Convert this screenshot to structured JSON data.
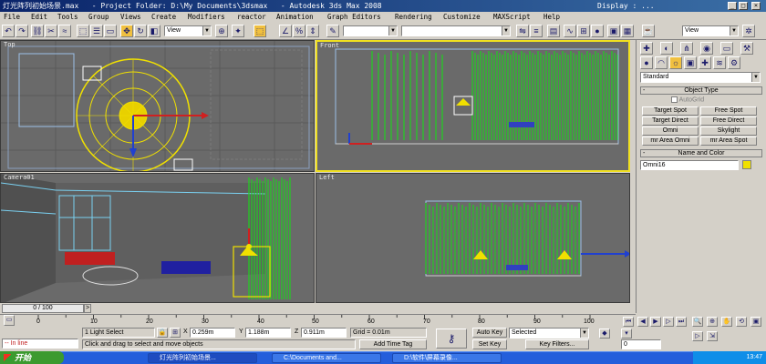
{
  "window": {
    "title": "灯光阵列初始场景.max   - Project Folder: D:\\My Documents\\3dsmax   - Autodesk 3ds Max 2008",
    "display_label": "Display : ..."
  },
  "menu": [
    "File",
    "Edit",
    "Tools",
    "Group",
    "Views",
    "Create",
    "Modifiers",
    "reactor",
    "Animation",
    "Graph Editors",
    "Rendering",
    "Customize",
    "MAXScript",
    "Help"
  ],
  "toolbar": {
    "view_combo": "View",
    "view_combo_right": "View"
  },
  "viewports": {
    "top": "Top",
    "front": "Front",
    "camera": "Camera01",
    "left": "Left"
  },
  "command_panel": {
    "category": "Standard",
    "object_type_header": "Object Type",
    "autogrid_label": "AutoGrid",
    "buttons": [
      "Target Spot",
      "Free Spot",
      "Target Direct",
      "Free Direct",
      "Omni",
      "Skylight",
      "mr Area Omni",
      "mr Area Spot"
    ],
    "name_color_header": "Name and Color",
    "object_name": "Omni16",
    "object_color": "#f0e000"
  },
  "timeline": {
    "frame_slider": "0 / 100",
    "ticks": [
      "0",
      "10",
      "20",
      "30",
      "40",
      "50",
      "60",
      "70",
      "80",
      "90",
      "100"
    ]
  },
  "status": {
    "maxscript_prompt": "-- In line",
    "selection": "1 Light Select",
    "x_label": "X",
    "x_value": "0.259m",
    "y_label": "Y",
    "y_value": "1.188m",
    "z_label": "Z",
    "z_value": "0.911m",
    "grid": "Grid = 0.01m",
    "prompt": "Click and drag to select and move objects",
    "add_time_tag": "Add Time Tag",
    "auto_key": "Auto Key",
    "set_key": "Set Key",
    "selected_combo": "Selected",
    "key_filters": "Key Filters...",
    "current_frame": "0"
  },
  "taskbar": {
    "start": "开始",
    "tasks": [
      "灯光阵列初始场景...",
      "C:\\Documents and...",
      "D:\\软件\\屏幕录像..."
    ],
    "clock": "13:47"
  }
}
